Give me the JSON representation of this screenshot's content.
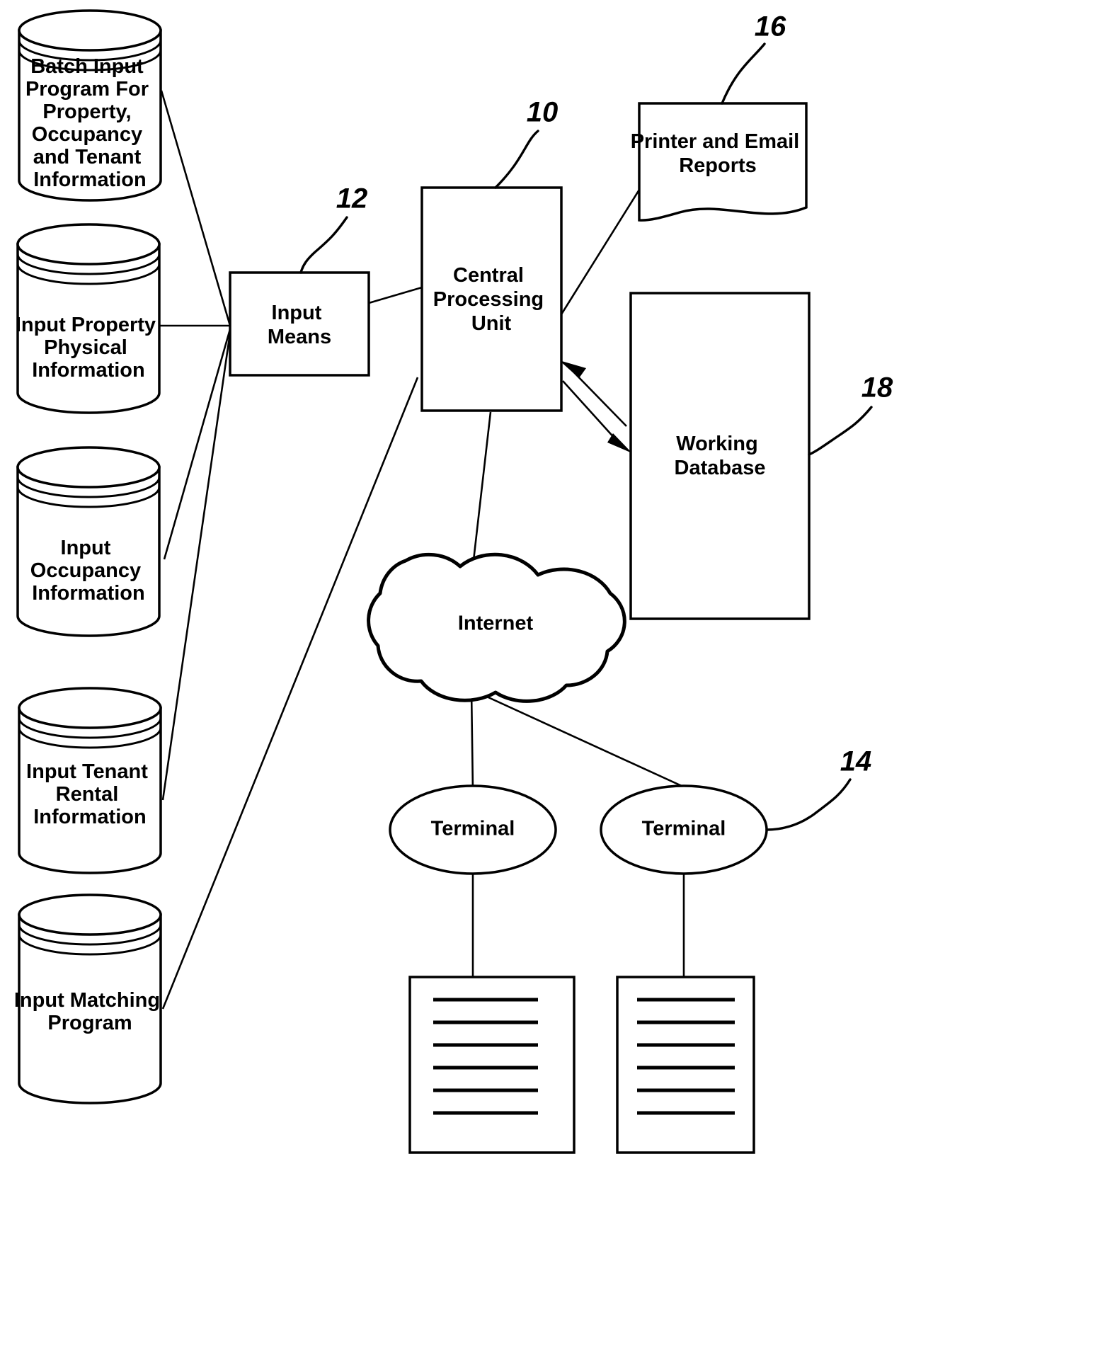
{
  "figure": {
    "title": "System architecture block diagram",
    "background_color": "#ffffff",
    "line_color": "#000000"
  },
  "databases": [
    {
      "id": "batch-input-program",
      "lines": [
        "Batch Input",
        "Program For",
        "Property,",
        "Occupancy",
        "and Tenant",
        "Information"
      ]
    },
    {
      "id": "input-property-physical",
      "lines": [
        "Input Property",
        "Physical",
        "Information"
      ]
    },
    {
      "id": "input-occupancy",
      "lines": [
        "Input",
        "Occupancy",
        "Information"
      ]
    },
    {
      "id": "input-tenant-rental",
      "lines": [
        "Input Tenant",
        "Rental",
        "Information"
      ]
    },
    {
      "id": "input-matching-program",
      "lines": [
        "Input Matching",
        "Program"
      ]
    }
  ],
  "boxes": {
    "input_means": {
      "lines": [
        "Input",
        "Means"
      ]
    },
    "cpu": {
      "lines": [
        "Central",
        "Processing",
        "Unit"
      ]
    },
    "printer_reports": {
      "lines": [
        "Printer and Email",
        "Reports"
      ]
    },
    "working_database": {
      "lines": [
        "Working",
        "Database"
      ]
    }
  },
  "cloud": {
    "label": "Internet"
  },
  "terminals": [
    {
      "label": "Terminal"
    },
    {
      "label": "Terminal"
    }
  ],
  "documents": [
    {
      "id": "document-left",
      "line_count": 6
    },
    {
      "id": "document-right",
      "line_count": 6
    }
  ],
  "reference_numerals": [
    {
      "id": "ref-16",
      "value": "16",
      "points_to": "printer_reports"
    },
    {
      "id": "ref-10",
      "value": "10",
      "points_to": "cpu"
    },
    {
      "id": "ref-12",
      "value": "12",
      "points_to": "input_means"
    },
    {
      "id": "ref-18",
      "value": "18",
      "points_to": "working_database"
    },
    {
      "id": "ref-14",
      "value": "14",
      "points_to": "terminal_right"
    }
  ]
}
